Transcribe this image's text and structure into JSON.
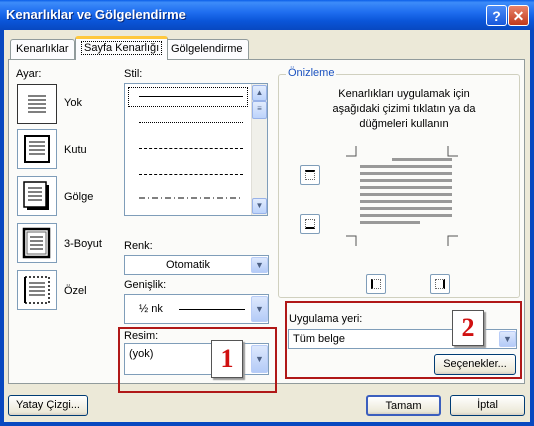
{
  "window": {
    "title": "Kenarlıklar ve Gölgelendirme",
    "help_label": "?",
    "close_label": "✕"
  },
  "tabs": [
    {
      "label": "Kenarlıklar",
      "active": false
    },
    {
      "label": "Sayfa Kenarlığı",
      "active": true
    },
    {
      "label": "Gölgelendirme",
      "active": false
    }
  ],
  "settings": {
    "label": "Ayar:",
    "items": [
      {
        "label": "Yok",
        "icon": "no-border-icon",
        "selected": true
      },
      {
        "label": "Kutu",
        "icon": "box-border-icon",
        "selected": false
      },
      {
        "label": "Gölge",
        "icon": "shadow-border-icon",
        "selected": false
      },
      {
        "label": "3-Boyut",
        "icon": "3d-border-icon",
        "selected": false
      },
      {
        "label": "Özel",
        "icon": "custom-border-icon",
        "selected": false
      }
    ]
  },
  "style": {
    "label": "Stil:",
    "lines": [
      "solid",
      "dotted-fine",
      "dashed-small",
      "dashed-medium",
      "dash-dot"
    ],
    "selected_index": 0
  },
  "color": {
    "label": "Renk:",
    "value": "Otomatik"
  },
  "width": {
    "label": "Genişlik:",
    "value": "½ nk"
  },
  "art": {
    "label": "Resim:",
    "value": "(yok)"
  },
  "preview": {
    "label": "Önizleme",
    "instructions": "Kenarlıkları uygulamak için aşağıdaki çizimi tıklatın ya da düğmeleri kullanın"
  },
  "apply_to": {
    "label": "Uygulama yeri:",
    "value": "Tüm belge"
  },
  "buttons": {
    "options": "Seçenekler...",
    "horizontal_line": "Yatay Çizgi...",
    "ok": "Tamam",
    "cancel": "İptal"
  },
  "annotations": {
    "badge1": "1",
    "badge2": "2"
  },
  "colors": {
    "accent_red": "#b01818",
    "titlebar_blue": "#0a55d8"
  }
}
